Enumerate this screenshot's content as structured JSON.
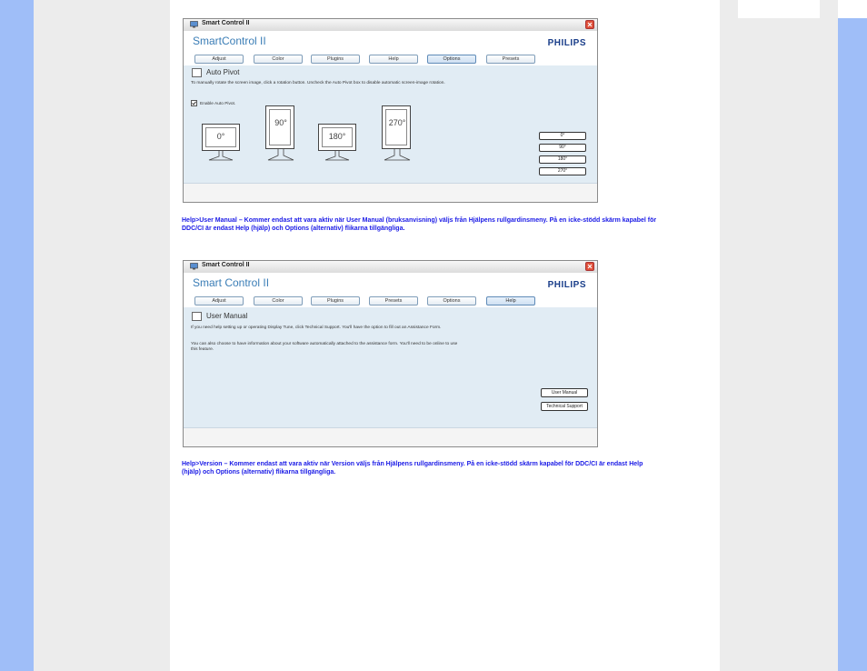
{
  "window1": {
    "title": "Smart Control II",
    "app_title": "SmartControl II",
    "brand": "PHILIPS",
    "tabs": [
      "Adjust",
      "Color",
      "Plugins",
      "Help",
      "Options",
      "Presets"
    ],
    "active_tab": "Options",
    "section_title": "Auto Pivot",
    "description": "To manually rotate the screen image, click a rotation button. Uncheck the Auto Pivot box to disable automatic screen-image rotation.",
    "checkbox_label": "Enable Auto Pivot.",
    "monitors": [
      "0°",
      "90°",
      "180°",
      "270°"
    ],
    "buttons": [
      "0°",
      "90°",
      "180°",
      "270°"
    ]
  },
  "paragraph1": "Help>User Manual – Kommer endast att vara aktiv när User Manual (bruksanvisning) väljs från Hjälpens rullgardinsmeny. På en icke-stödd skärm kapabel för DDC/CI är endast Help (hjälp) och Options (alternativ) flikarna tillgängliga.",
  "window2": {
    "title": "Smart Control II",
    "app_title": "Smart Control II",
    "brand": "PHILIPS",
    "tabs": [
      "Adjust",
      "Color",
      "Plugins",
      "Presets",
      "Options",
      "Help"
    ],
    "active_tab": "Help",
    "section_title": "User Manual",
    "description1": "If you need help setting up or operating Display Tune, click Technical Support. You'll have the option to fill out an Assistance Form.",
    "description2": "You can also choose to have information about your software automatically attached to the assistance form. You'll need to be online to use this feature.",
    "buttons": [
      "User Manual",
      "Technical Support"
    ]
  },
  "paragraph2": "Help>Version – Kommer endast att vara aktiv när Version väljs från Hjälpens rullgardinsmeny. På en icke-stödd skärm kapabel för DDC/CI är endast Help (hjälp) och Options (alternativ) flikarna tillgängliga.",
  "colors": {
    "side_bar": "#9fbef8",
    "gutter": "#ececec",
    "paragraph_text": "#1a1ae6",
    "content_bg": "#e1ecf4",
    "app_title": "#3a7db6",
    "brand": "#1a3e8a"
  }
}
